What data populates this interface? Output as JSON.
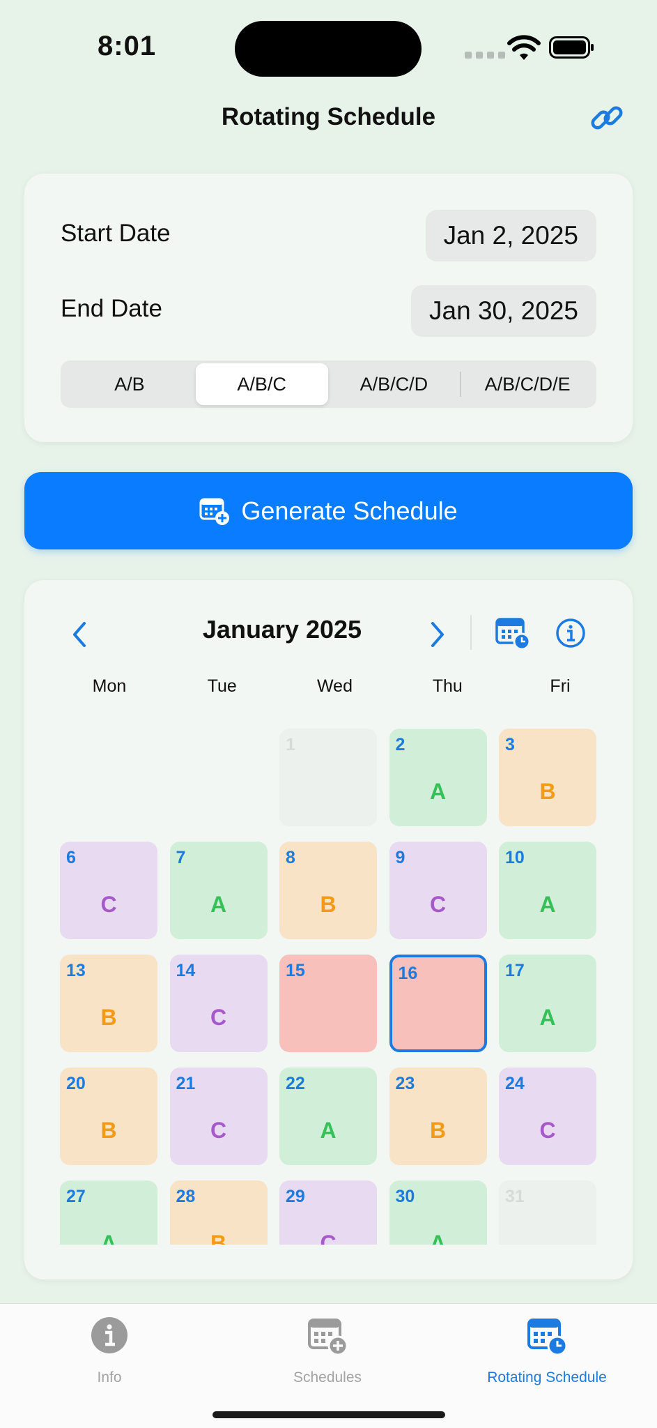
{
  "status": {
    "time": "8:01"
  },
  "nav": {
    "title": "Rotating Schedule",
    "link_icon": "link-icon"
  },
  "dates": {
    "start_label": "Start Date",
    "start_value": "Jan 2, 2025",
    "end_label": "End Date",
    "end_value": "Jan 30, 2025"
  },
  "rotation": {
    "options": [
      "A/B",
      "A/B/C",
      "A/B/C/D",
      "A/B/C/D/E"
    ],
    "selected": "A/B/C"
  },
  "generate": {
    "label": "Generate Schedule",
    "icon": "calendar-add-icon"
  },
  "calendar": {
    "month": "January 2025",
    "weekdays": [
      "Mon",
      "Tue",
      "Wed",
      "Thu",
      "Fri"
    ],
    "days": [
      {
        "n": "1",
        "type": "empty",
        "col": 2,
        "row": 0
      },
      {
        "n": "2",
        "type": "A",
        "col": 3,
        "row": 0
      },
      {
        "n": "3",
        "type": "B",
        "col": 4,
        "row": 0
      },
      {
        "n": "6",
        "type": "C",
        "col": 0,
        "row": 1
      },
      {
        "n": "7",
        "type": "A",
        "col": 1,
        "row": 1
      },
      {
        "n": "8",
        "type": "B",
        "col": 2,
        "row": 1
      },
      {
        "n": "9",
        "type": "C",
        "col": 3,
        "row": 1
      },
      {
        "n": "10",
        "type": "A",
        "col": 4,
        "row": 1
      },
      {
        "n": "13",
        "type": "B",
        "col": 0,
        "row": 2
      },
      {
        "n": "14",
        "type": "C",
        "col": 1,
        "row": 2
      },
      {
        "n": "15",
        "type": "off",
        "col": 2,
        "row": 2
      },
      {
        "n": "16",
        "type": "off",
        "col": 3,
        "row": 2,
        "selected": true
      },
      {
        "n": "17",
        "type": "A",
        "col": 4,
        "row": 2
      },
      {
        "n": "20",
        "type": "B",
        "col": 0,
        "row": 3
      },
      {
        "n": "21",
        "type": "C",
        "col": 1,
        "row": 3
      },
      {
        "n": "22",
        "type": "A",
        "col": 2,
        "row": 3
      },
      {
        "n": "23",
        "type": "B",
        "col": 3,
        "row": 3
      },
      {
        "n": "24",
        "type": "C",
        "col": 4,
        "row": 3
      },
      {
        "n": "27",
        "type": "A",
        "col": 0,
        "row": 4
      },
      {
        "n": "28",
        "type": "B",
        "col": 1,
        "row": 4
      },
      {
        "n": "29",
        "type": "C",
        "col": 2,
        "row": 4
      },
      {
        "n": "30",
        "type": "A",
        "col": 3,
        "row": 4
      },
      {
        "n": "31",
        "type": "empty",
        "col": 4,
        "row": 4
      }
    ]
  },
  "colors": {
    "accent": "#0a7cff",
    "A": "#35c059",
    "B": "#f39a16",
    "C": "#a65ac9",
    "off": "#f8c0bb"
  },
  "tabs": [
    {
      "label": "Info",
      "icon": "info-icon",
      "active": false
    },
    {
      "label": "Schedules",
      "icon": "calendar-add-icon",
      "active": false
    },
    {
      "label": "Rotating Schedule",
      "icon": "calendar-clock-icon",
      "active": true
    }
  ]
}
